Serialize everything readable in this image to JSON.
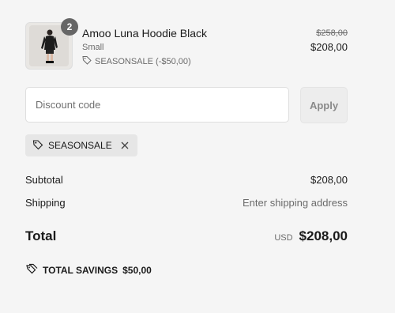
{
  "line_item": {
    "quantity": "2",
    "name": "Amoo Luna Hoodie Black",
    "variant": "Small",
    "discount": "SEASONSALE (-$50,00)",
    "original_price": "$258,00",
    "price": "$208,00",
    "icons": {
      "discount": "tag-icon"
    }
  },
  "discount": {
    "placeholder": "Discount code",
    "value": "",
    "apply_label": "Apply"
  },
  "applied_code": {
    "code": "SEASONSALE",
    "icons": {
      "tag": "tag-icon",
      "remove": "close-icon"
    }
  },
  "summary": {
    "subtotal_label": "Subtotal",
    "subtotal_value": "$208,00",
    "shipping_label": "Shipping",
    "shipping_value": "Enter shipping address",
    "total_label": "Total",
    "currency": "USD",
    "total_value": "$208,00",
    "savings_label": "TOTAL SAVINGS",
    "savings_value": "$50,00",
    "icons": {
      "savings": "tags-icon"
    }
  },
  "colors": {
    "background": "#f5f5f5",
    "badge": "#666666",
    "text": "#1a1a1a",
    "muted": "#6b6b6b"
  }
}
